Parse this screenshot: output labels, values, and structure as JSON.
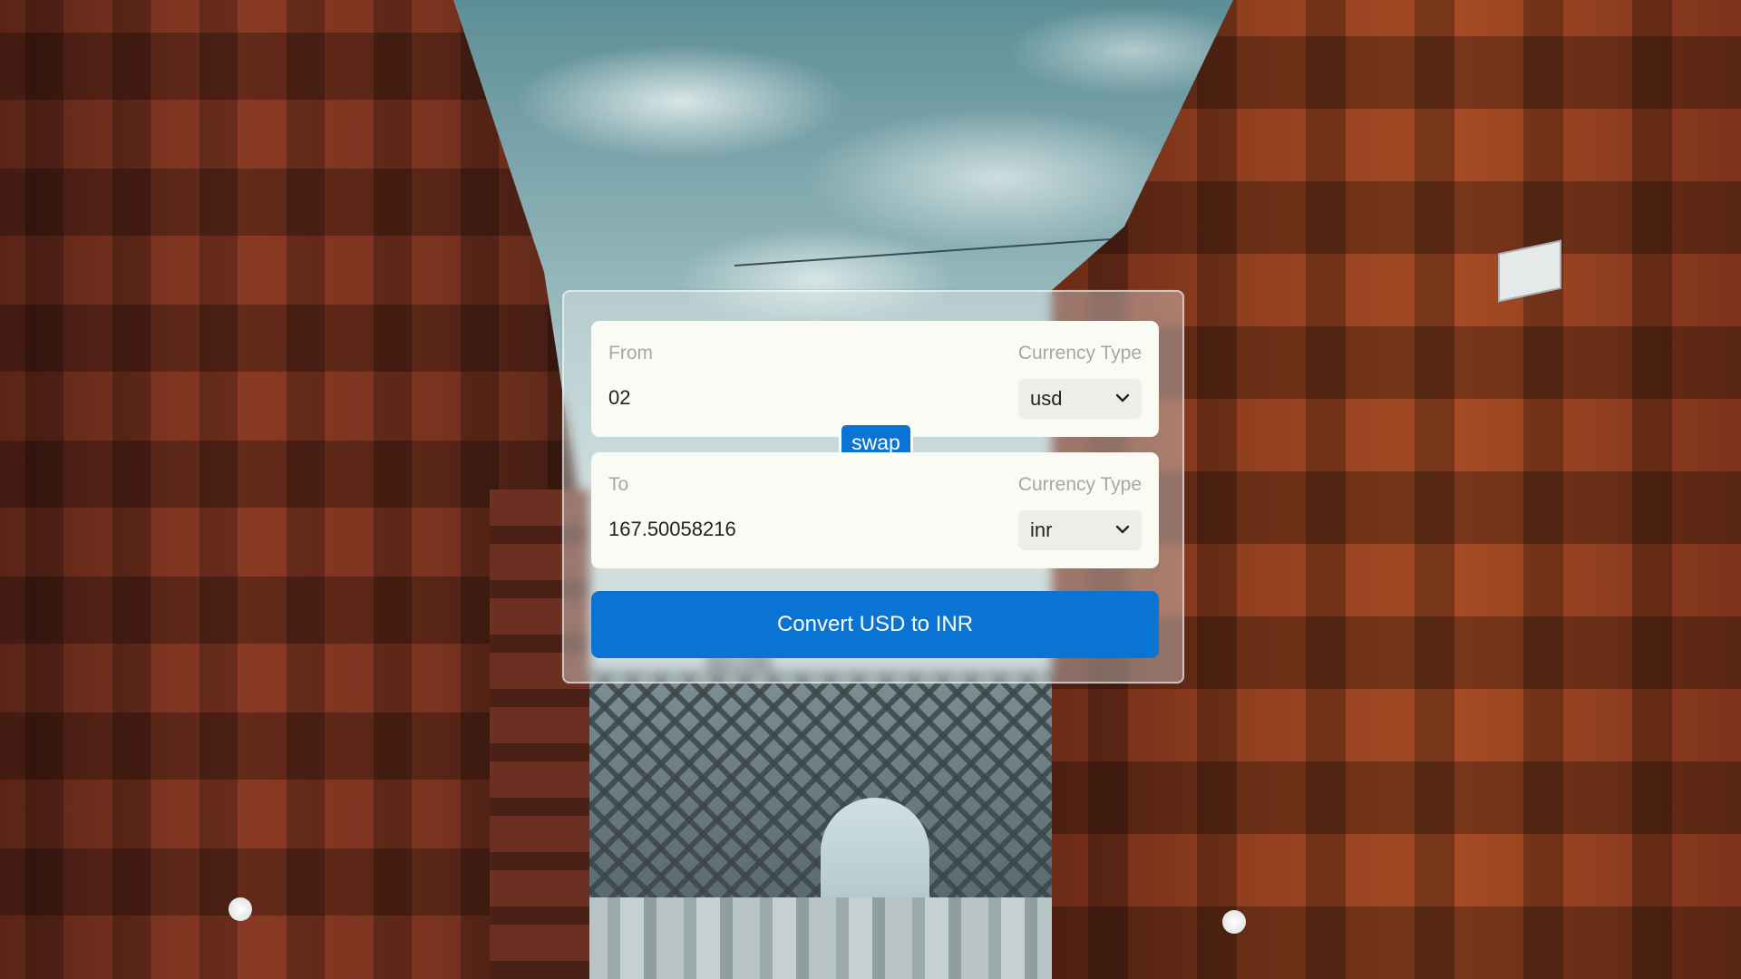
{
  "converter": {
    "from": {
      "label": "From",
      "currency_type_label": "Currency Type",
      "amount": "02",
      "currency": "usd"
    },
    "to": {
      "label": "To",
      "currency_type_label": "Currency Type",
      "amount": "167.50058216",
      "currency": "inr"
    },
    "swap_label": "swap",
    "convert_label": "Convert USD to INR"
  },
  "colors": {
    "accent": "#0a74d4",
    "panel": "#fbfbf6",
    "label": "#a8a8a0"
  },
  "icons": [
    "chevron-down-icon"
  ]
}
